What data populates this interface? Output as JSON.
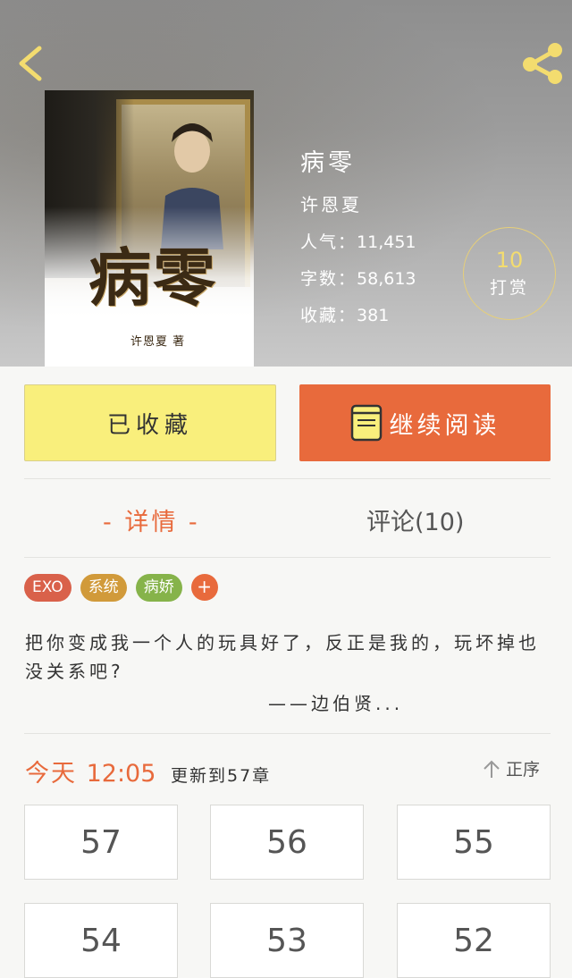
{
  "book": {
    "title": "病零",
    "author": "许恩夏",
    "cover_title": "病零",
    "cover_author": "许恩夏 著",
    "stats": [
      {
        "label": "人气：",
        "value": "11,451"
      },
      {
        "label": "字数：",
        "value": "58,613"
      },
      {
        "label": "收藏：",
        "value": "381"
      }
    ]
  },
  "tip": {
    "count": "10",
    "label": "打赏"
  },
  "actions": {
    "favorite_label": "已收藏",
    "read_label": "继续阅读"
  },
  "tabs": {
    "detail": "- 详情 -",
    "comments": "评论(10)"
  },
  "tags": [
    {
      "label": "EXO",
      "color": "#d9614a"
    },
    {
      "label": "系统",
      "color": "#d19a3a"
    },
    {
      "label": "病娇",
      "color": "#86b34a"
    }
  ],
  "tag_add": "+",
  "summary": {
    "text": "把你变成我一个人的玩具好了，反正是我的，玩坏掉也没关系吧?",
    "signature": "——边伯贤..."
  },
  "update": {
    "day": "今天",
    "time": "12:05",
    "text": "更新到57章"
  },
  "sort_label": "正序",
  "chapters": [
    "57",
    "56",
    "55",
    "54",
    "53",
    "52"
  ],
  "colors": {
    "accent": "#e86a3c",
    "favorite_bg": "#f9ef7c",
    "tip_gold": "#f3dc6f"
  }
}
